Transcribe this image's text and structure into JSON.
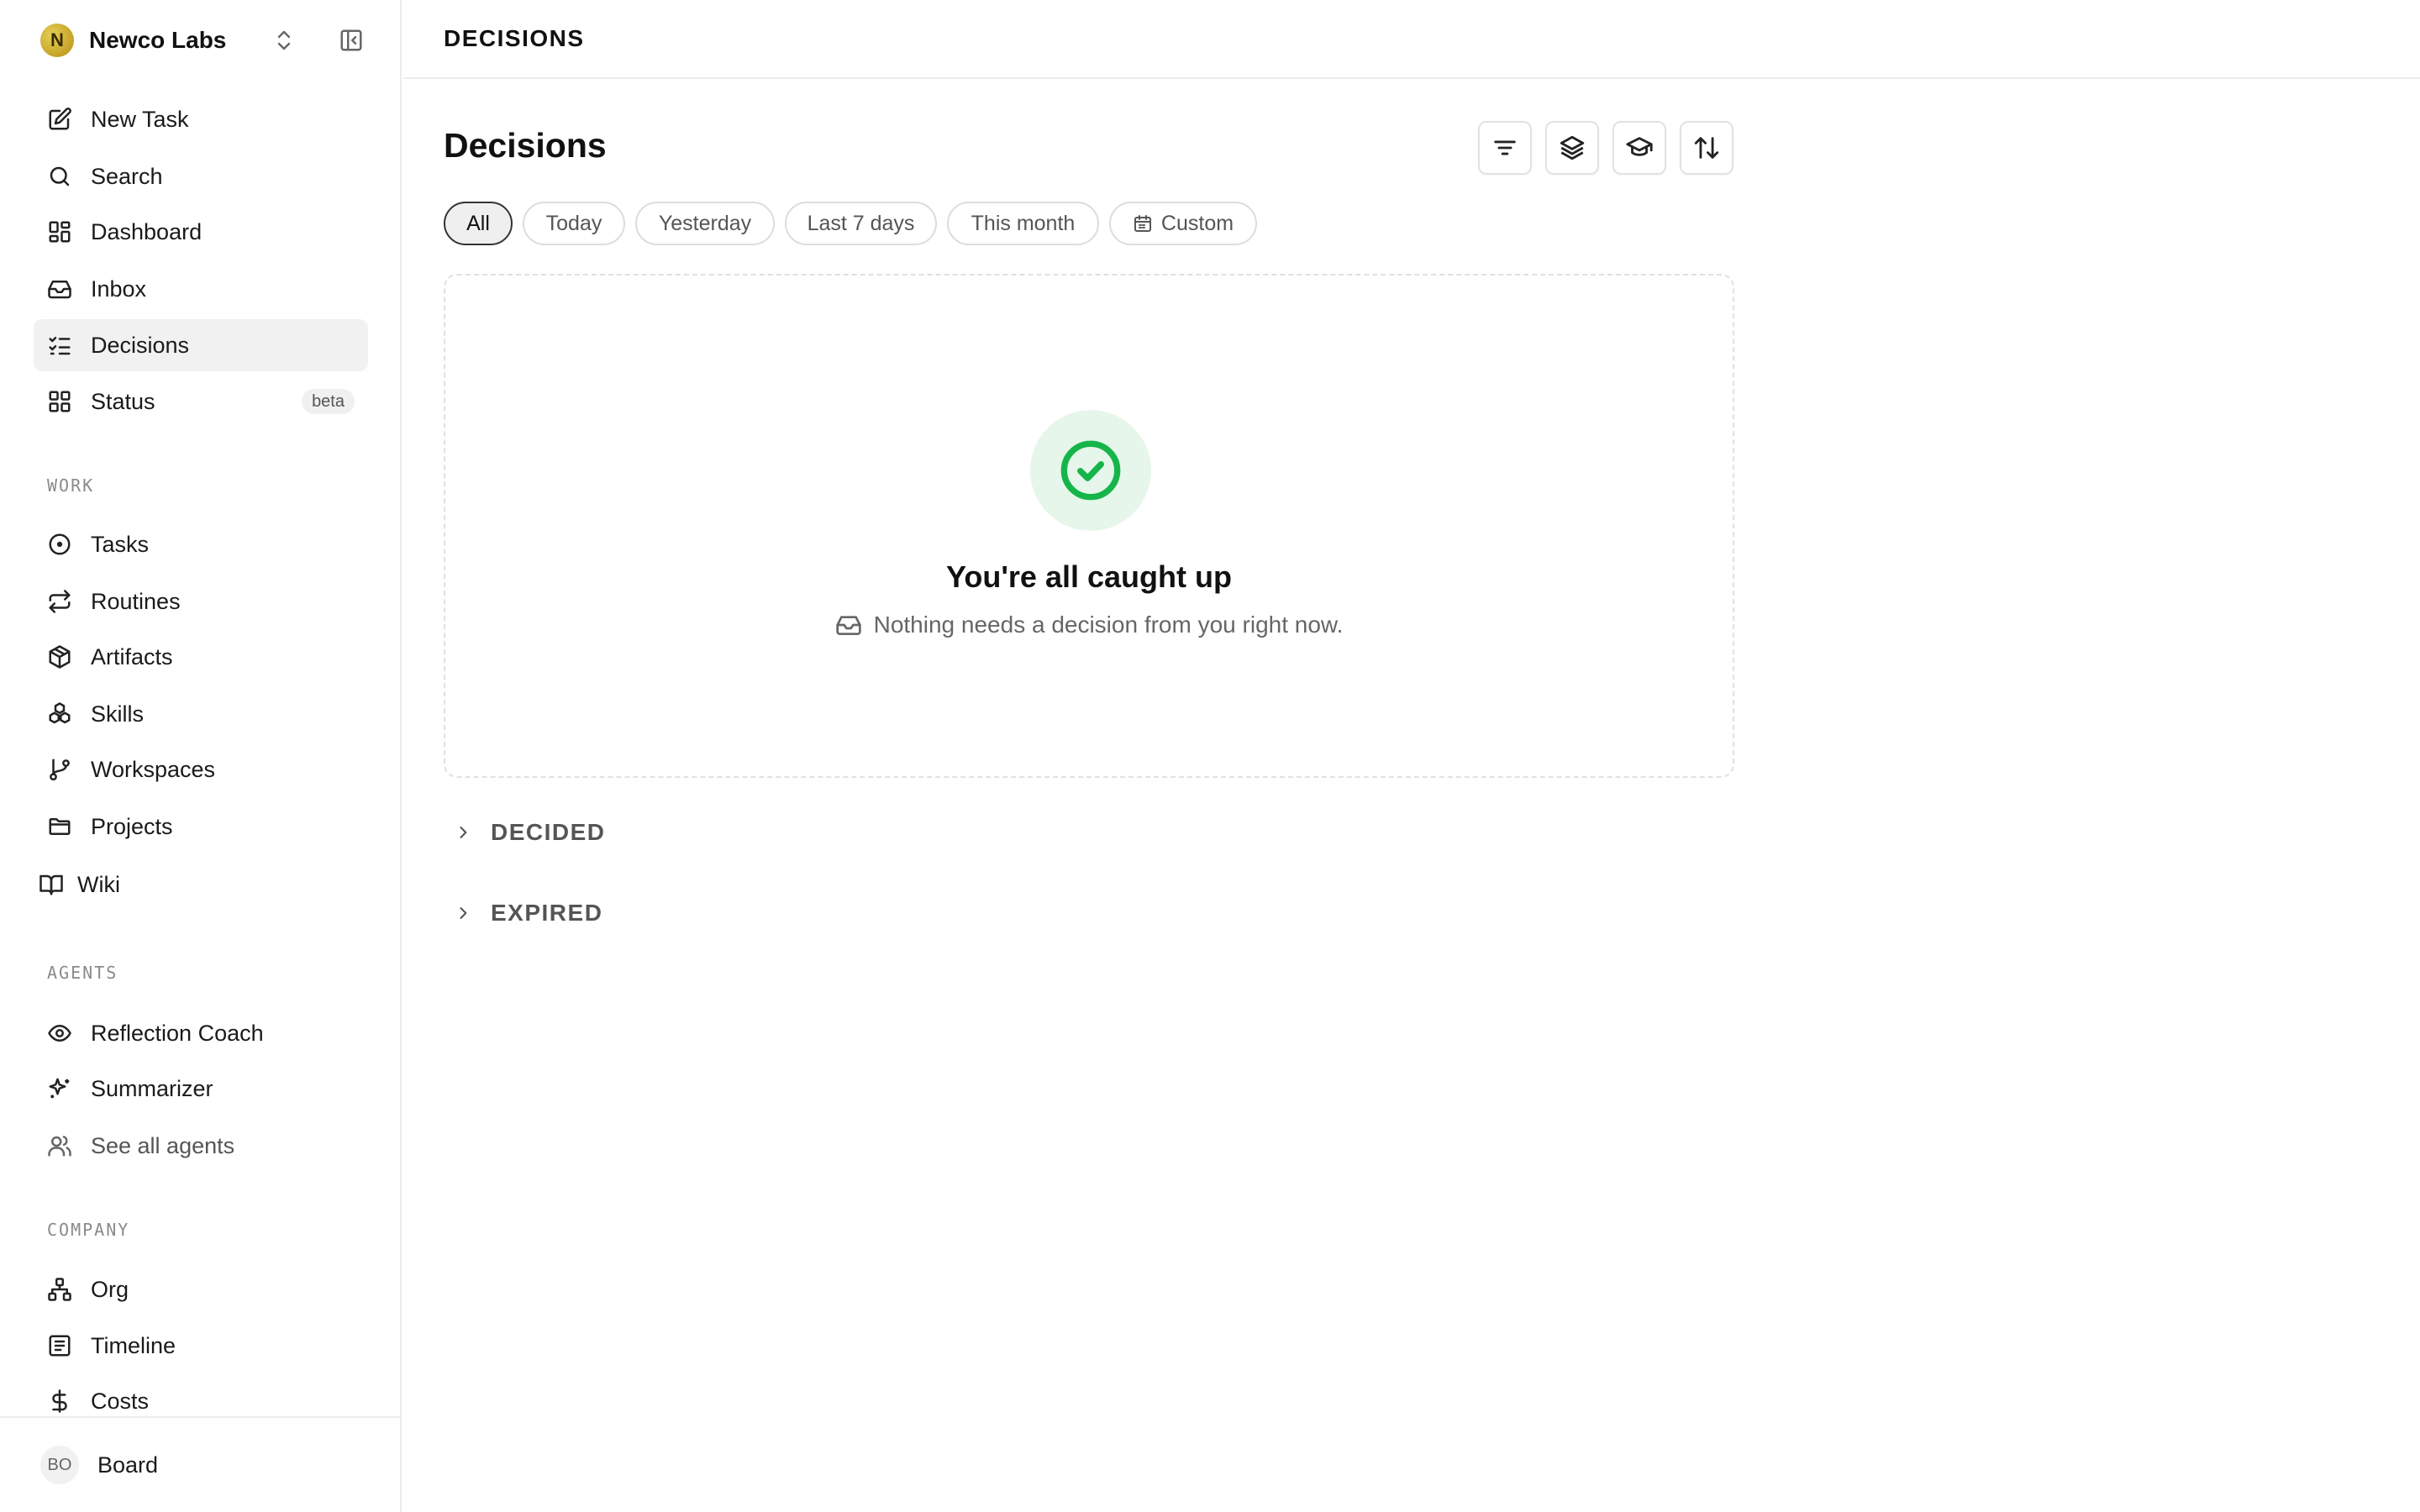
{
  "workspace": {
    "initial": "N",
    "name": "Newco Labs"
  },
  "nav_primary": [
    {
      "label": "New Task",
      "icon": "edit-icon"
    },
    {
      "label": "Search",
      "icon": "search-icon"
    },
    {
      "label": "Dashboard",
      "icon": "dashboard-icon"
    },
    {
      "label": "Inbox",
      "icon": "inbox-icon"
    },
    {
      "label": "Decisions",
      "icon": "checklist-icon",
      "active": true
    },
    {
      "label": "Status",
      "icon": "grid-icon",
      "badge": "beta"
    }
  ],
  "sections": {
    "work": "WORK",
    "agents": "AGENTS",
    "company": "COMPANY"
  },
  "nav_work": [
    {
      "label": "Tasks",
      "icon": "circle-dot-icon"
    },
    {
      "label": "Routines",
      "icon": "repeat-icon"
    },
    {
      "label": "Artifacts",
      "icon": "box-icon"
    },
    {
      "label": "Skills",
      "icon": "skills-icon"
    },
    {
      "label": "Workspaces",
      "icon": "git-branch-icon"
    },
    {
      "label": "Projects",
      "icon": "folder-icon"
    },
    {
      "label": "Wiki",
      "icon": "book-icon"
    }
  ],
  "nav_agents": [
    {
      "label": "Reflection Coach",
      "icon": "eye-icon"
    },
    {
      "label": "Summarizer",
      "icon": "sparkles-icon"
    },
    {
      "label": "See all agents",
      "icon": "users-icon"
    }
  ],
  "nav_company": [
    {
      "label": "Org",
      "icon": "org-chart-icon"
    },
    {
      "label": "Timeline",
      "icon": "timeline-icon"
    },
    {
      "label": "Costs",
      "icon": "dollar-icon"
    }
  ],
  "user": {
    "initials": "BO",
    "name": "Board"
  },
  "topbar": {
    "title": "DECISIONS"
  },
  "page": {
    "title": "Decisions"
  },
  "toolbar": [
    "filter-icon",
    "layers-icon",
    "graduation-cap-icon",
    "sort-icon"
  ],
  "filters": [
    "All",
    "Today",
    "Yesterday",
    "Last 7 days",
    "This month",
    "Custom"
  ],
  "active_filter": "All",
  "empty_state": {
    "title": "You're all caught up",
    "subtitle": "Nothing needs a decision from you right now."
  },
  "groups": [
    "DECIDED",
    "EXPIRED"
  ],
  "colors": {
    "success": "#16b54a",
    "success_bg": "#e6f6ea",
    "active_bg": "#f1f1f1"
  }
}
